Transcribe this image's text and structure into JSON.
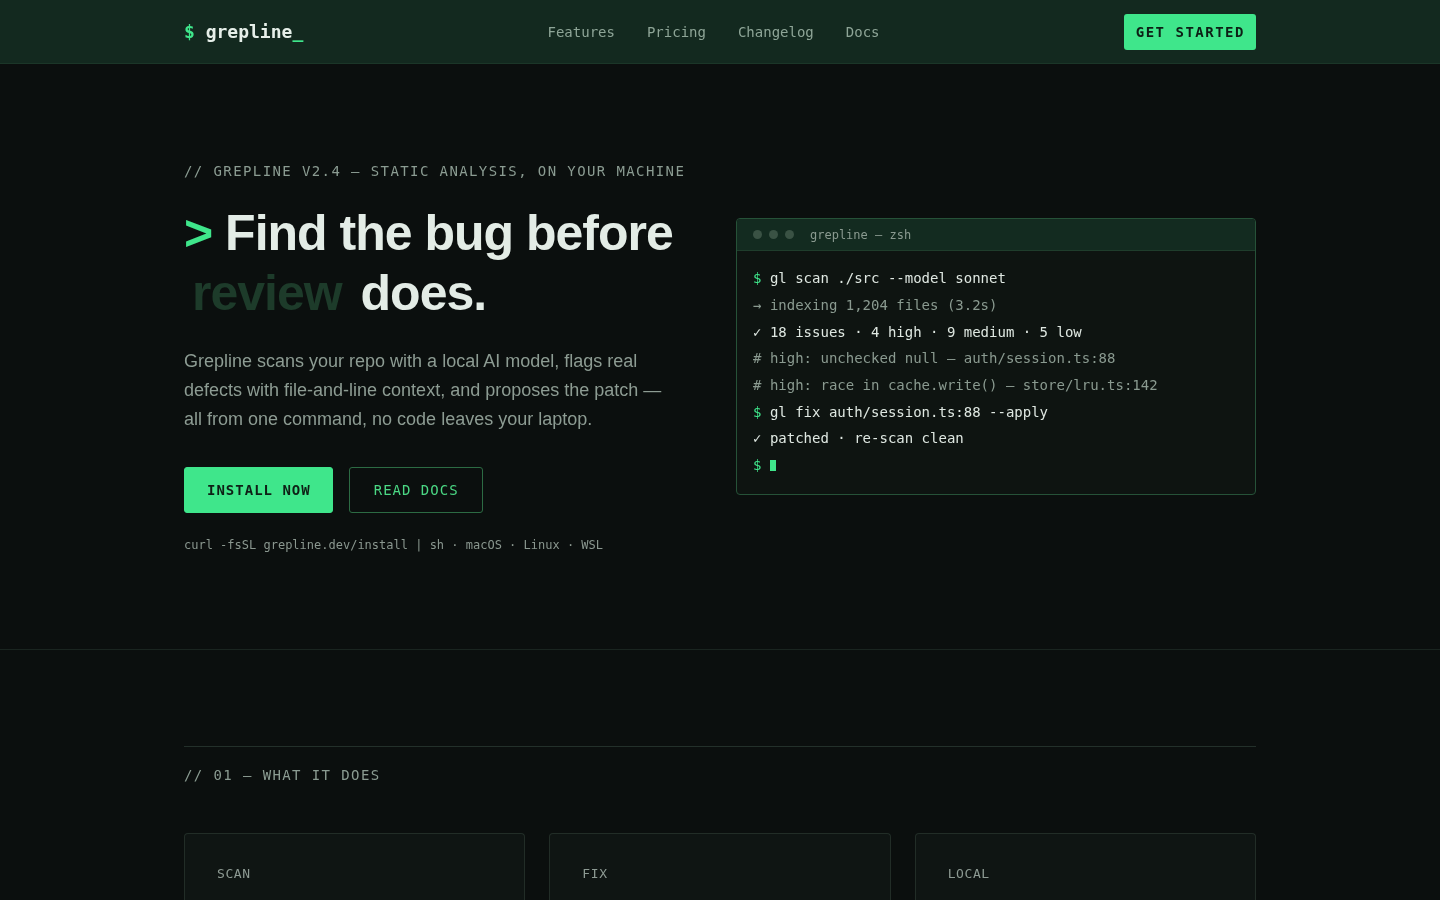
{
  "nav": {
    "logo": {
      "prompt": "$",
      "name": "grepline",
      "cursor": "_"
    },
    "links": [
      "Features",
      "Pricing",
      "Changelog",
      "Docs"
    ],
    "cta": "GET STARTED"
  },
  "hero": {
    "eyebrow": "// GREPLINE V2.4 — STATIC ANALYSIS, ON YOUR MACHINE",
    "heading": {
      "prompt": ">",
      "parts": [
        {
          "text": "Find the bug before",
          "kind": "plain"
        },
        {
          "text": "review",
          "kind": "muted"
        },
        {
          "text": "does.",
          "kind": "plain"
        }
      ]
    },
    "description": "Grepline scans your repo with a local AI model, flags real defects with file-and-line context, and proposes the patch — all from one command, no code leaves your laptop.",
    "buttons": [
      {
        "label": "INSTALL NOW",
        "kind": "primary"
      },
      {
        "label": "READ DOCS",
        "kind": "outline"
      }
    ],
    "install_note": "curl -fsSL grepline.dev/install | sh · macOS · Linux · WSL"
  },
  "terminal": {
    "title": "grepline — zsh",
    "lines": [
      {
        "kind": "command",
        "prompt": "$",
        "text": "gl scan ./src --model sonnet"
      },
      {
        "kind": "info",
        "prompt": "→",
        "text": "indexing 1,204 files (3.2s)"
      },
      {
        "kind": "success",
        "prompt": "✓",
        "text": "18 issues · 4 high · 9 medium · 5 low"
      },
      {
        "kind": "comment",
        "prompt": "#",
        "text": "high: unchecked null — auth/session.ts:88"
      },
      {
        "kind": "comment",
        "prompt": "#",
        "text": "high: race in cache.write() — store/lru.ts:142"
      },
      {
        "kind": "command",
        "prompt": "$",
        "text": "gl fix auth/session.ts:88 --apply"
      },
      {
        "kind": "success",
        "prompt": "✓",
        "text": "patched · re-scan clean"
      },
      {
        "kind": "input",
        "prompt": "$"
      }
    ]
  },
  "features": {
    "label": "// 01 — WHAT IT DOES",
    "cards": [
      {
        "label": "SCAN"
      },
      {
        "label": "FIX"
      },
      {
        "label": "LOCAL"
      }
    ]
  }
}
